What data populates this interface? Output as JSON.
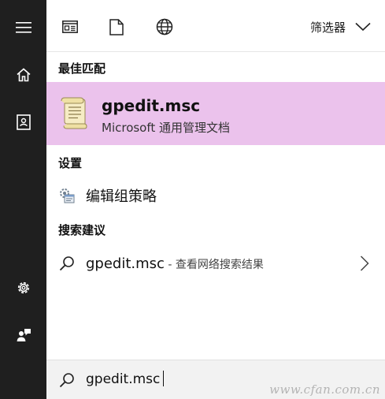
{
  "rail": {
    "icons": [
      "hamburger-icon",
      "home-icon",
      "notebook-icon",
      "settings-icon",
      "feedback-icon"
    ]
  },
  "toolbar": {
    "icons": [
      "apps-filter-icon",
      "documents-filter-icon",
      "web-filter-icon"
    ],
    "filter_label": "筛选器"
  },
  "sections": {
    "best_match": "最佳匹配",
    "settings": "设置",
    "suggestions": "搜索建议"
  },
  "best_match": {
    "title": "gpedit.msc",
    "subtitle": "Microsoft 通用管理文档",
    "icon": "scroll-document-icon"
  },
  "settings_result": {
    "label": "编辑组策略",
    "icon": "group-policy-icon"
  },
  "suggestion": {
    "query": "gpedit.msc",
    "hint": " - 查看网络搜索结果",
    "icon": "search-icon"
  },
  "search_box": {
    "value": "gpedit.msc",
    "icon": "search-icon"
  },
  "watermark": "www.cfan.com.cn",
  "colors": {
    "rail_bg": "#1f1f1f",
    "highlight_bg": "#ebc2ec",
    "search_bg": "#f2f2f2"
  }
}
